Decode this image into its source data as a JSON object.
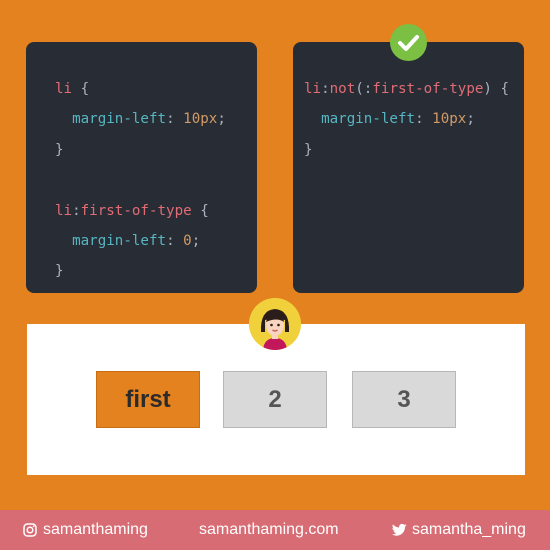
{
  "code_left": {
    "line1_selector": "li",
    "line1_brace": " {",
    "line2_property": "margin-left",
    "line2_colon": ": ",
    "line2_value": "10px",
    "line2_semicolon": ";",
    "line3_brace": "}",
    "line5_selector": "li",
    "line5_pseudo": ":first-of-type",
    "line5_brace": " {",
    "line6_property": "margin-left",
    "line6_colon": ": ",
    "line6_value": "0",
    "line6_semicolon": ";",
    "line7_brace": "}"
  },
  "code_right": {
    "line1_selector": "li",
    "line1_pseudo_open": ":not(",
    "line1_pseudo_inner": ":first-of-type",
    "line1_pseudo_close": ")",
    "line1_brace": " {",
    "line2_property": "margin-left",
    "line2_colon": ": ",
    "line2_value": "10px",
    "line2_semicolon": ";",
    "line3_brace": "}"
  },
  "list_items": [
    "first",
    "2",
    "3"
  ],
  "footer": {
    "instagram_handle": "samanthaming",
    "website": "samanthaming.com",
    "twitter_handle": "samantha_ming"
  },
  "colors": {
    "background": "#e3821f",
    "code_panel": "#282c34",
    "selector": "#e06c75",
    "property": "#56b6c2",
    "value": "#d19a66",
    "check": "#7bc043",
    "footer": "#d86c74"
  },
  "icons": [
    "check-icon",
    "avatar-icon",
    "instagram-icon",
    "twitter-icon"
  ]
}
